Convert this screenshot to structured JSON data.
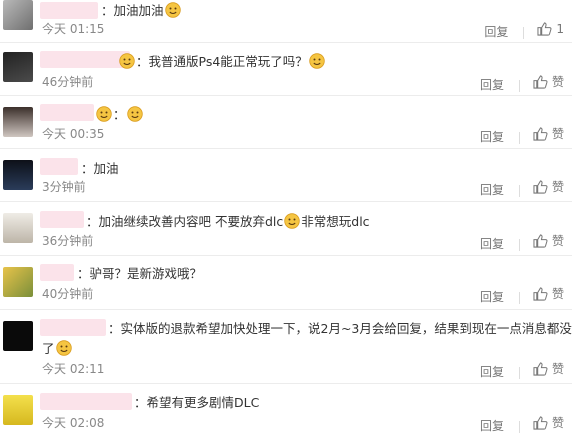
{
  "comments": [
    {
      "text": "：加油加油",
      "emoji_after": "blush-emoji",
      "time": "今天 01:15",
      "reply": "回复",
      "like": "1"
    },
    {
      "text": "：我普通版Ps4能正常玩了吗？",
      "emoji_after": "confused-emoji",
      "time": "46分钟前",
      "reply": "回复",
      "like": "赞"
    },
    {
      "text": "：",
      "emoji_after": "laugh-emoji",
      "time": "今天 00:35",
      "reply": "回复",
      "like": "赞"
    },
    {
      "text": "：加油",
      "time": "3分钟前",
      "reply": "回复",
      "like": "赞"
    },
    {
      "text": "：加油继续改善内容吧 不要放弃dlc",
      "emoji_mid": "sweat-emoji",
      "text_after": "非常想玩dlc",
      "time": "36分钟前",
      "reply": "回复",
      "like": "赞"
    },
    {
      "text": "：驴哥？是新游戏哦？",
      "time": "40分钟前",
      "reply": "回复",
      "like": "赞"
    },
    {
      "text": "：实体版的退款希望加快处理一下，说2月~3月会给回复，结果到现在一点消息都没有",
      "text_line2": "了",
      "emoji_after": "smile-emoji",
      "time": "今天 02:11",
      "reply": "回复",
      "like": "赞"
    },
    {
      "text": "：希望有更多剧情DLC",
      "time": "今天 02:08",
      "reply": "回复",
      "like": "赞"
    }
  ],
  "colors": {
    "text": "#333333",
    "meta": "#888888",
    "name_blur": "#fbe3ea",
    "emoji": "#f5c542"
  }
}
